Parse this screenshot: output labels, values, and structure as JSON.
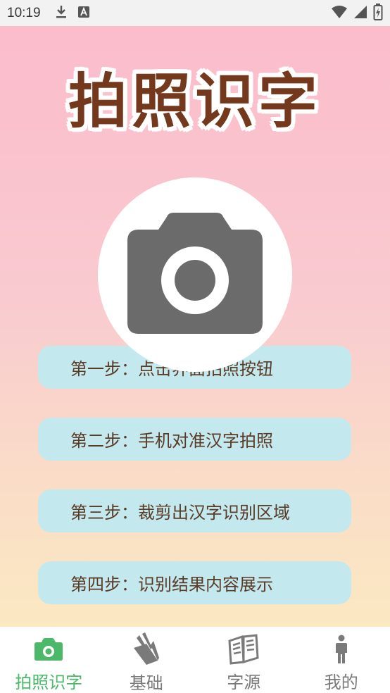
{
  "status_bar": {
    "time": "10:19"
  },
  "app": {
    "title": "拍照识字"
  },
  "steps": [
    "第一步：点击界面拍照按钮",
    "第二步：手机对准汉字拍照",
    "第三步：裁剪出汉字识别区域",
    "第四步：识别结果内容展示"
  ],
  "camera_button": {
    "icon": "camera-icon"
  },
  "bottom_nav": {
    "items": [
      {
        "label": "拍照识字",
        "icon": "camera-icon",
        "active": true
      },
      {
        "label": "基础",
        "icon": "book-stack-icon",
        "active": false
      },
      {
        "label": "字源",
        "icon": "open-book-icon",
        "active": false
      },
      {
        "label": "我的",
        "icon": "person-icon",
        "active": false
      }
    ]
  },
  "colors": {
    "accent": "#4cb96a",
    "title": "#74391c",
    "step_bg": "#c3e9ef",
    "icon_gray": "#6b6b6b"
  }
}
